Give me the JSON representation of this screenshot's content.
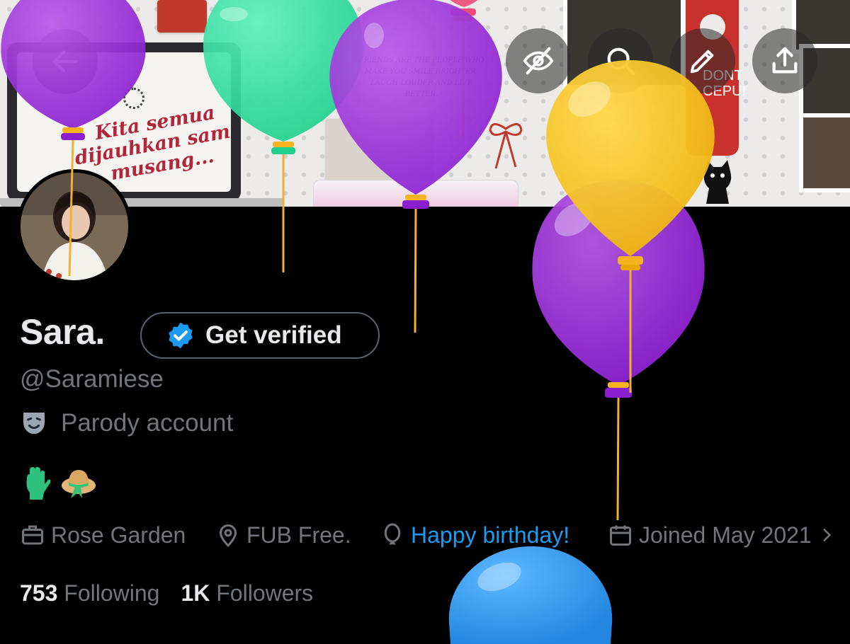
{
  "banner": {
    "laptop_text": "Kita semua dijauhkan sama musang...",
    "note_text": "FRIENDS ARE THE PEOPLE WHO MAKE YOU SMILE BRIGHTER, LAUGH LOUDER AND LIVE BETTER.",
    "door_hanger_text": "DONT CEPU!"
  },
  "header": {
    "back_icon": "arrow-left-icon",
    "mute_icon": "eye-slash-icon",
    "search_icon": "search-icon",
    "edit_icon": "pencil-icon",
    "share_icon": "share-icon"
  },
  "profile": {
    "display_name": "Sara.",
    "verify_label": "Get verified",
    "handle": "@Saramiese",
    "parody_label": "Parody account",
    "bio_emojis": [
      "🧤",
      "👒"
    ]
  },
  "info": {
    "location_work": "Rose Garden",
    "location": "FUB Free.",
    "birthday": "Happy birthday!",
    "joined": "Joined May 2021"
  },
  "stats": {
    "following_count": "753",
    "following_label": "Following",
    "followers_count": "1K",
    "followers_label": "Followers"
  },
  "colors": {
    "accent": "#1d9bf0",
    "muted_text": "#71767b",
    "balloon_purple": "#9b30d9",
    "balloon_green": "#2fe3a0",
    "balloon_yellow": "#f5c21f",
    "balloon_blue": "#3aa0f0"
  }
}
